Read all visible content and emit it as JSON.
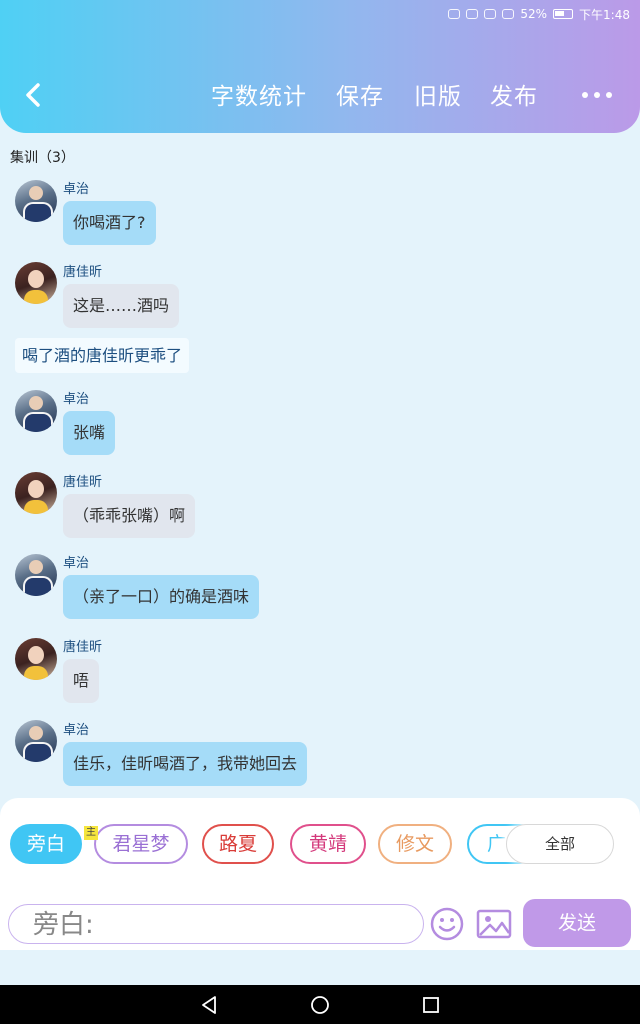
{
  "status_bar": {
    "battery": "52%",
    "time": "下午1:48"
  },
  "header": {
    "toolbar": {
      "word_count": "字数统计",
      "save": "保存",
      "old_version": "旧版",
      "publish": "发布"
    }
  },
  "chat": {
    "group_title": "集训（3）",
    "messages": [
      {
        "sender": "卓治",
        "text": "你喝酒了?"
      },
      {
        "sender": "唐佳昕",
        "text": "这是……酒吗"
      },
      {
        "sender": "卓治",
        "text": "张嘴"
      },
      {
        "sender": "唐佳昕",
        "text": "（乖乖张嘴）啊"
      },
      {
        "sender": "卓治",
        "text": "（亲了一口）的确是酒味"
      },
      {
        "sender": "唐佳昕",
        "text": "唔"
      },
      {
        "sender": "卓治",
        "text": "佳乐，佳昕喝酒了，我带她回去"
      }
    ],
    "narration": "喝了酒的唐佳昕更乖了"
  },
  "input_panel": {
    "main_badge": "主",
    "characters": [
      {
        "label": "旁白",
        "color": "#40c6f4"
      },
      {
        "label": "君星梦",
        "color": "#b48ce0"
      },
      {
        "label": "路夏",
        "color": "#e0504c"
      },
      {
        "label": "黄靖",
        "color": "#e0508c"
      },
      {
        "label": "修文",
        "color": "#f0b080"
      },
      {
        "label": "广",
        "color": "#40c6f4"
      }
    ],
    "all_button": "全部",
    "input_prefix": "旁白:",
    "send_button": "发送"
  }
}
